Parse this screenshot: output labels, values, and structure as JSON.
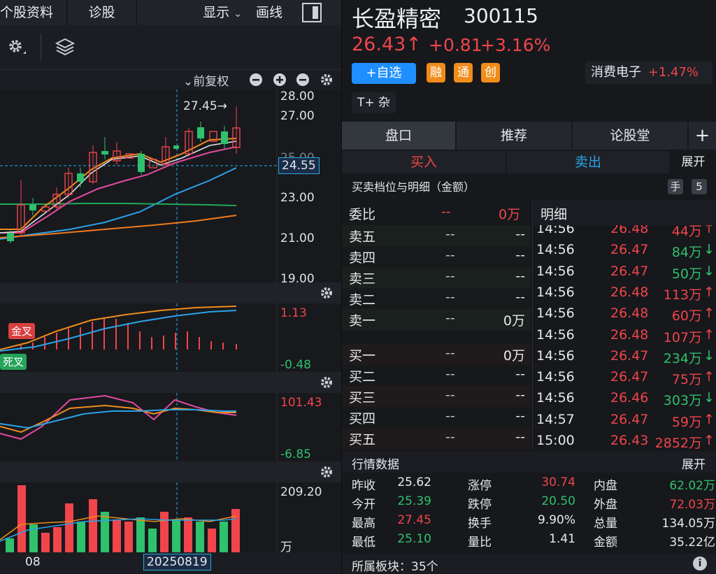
{
  "left": {
    "tabs": [
      "个股资料",
      "诊股"
    ],
    "display_label": "显示",
    "draw_label": "画线",
    "adjust_label": "前复权",
    "price_axis": [
      "28.00",
      "27.00",
      "23.00",
      "21.00",
      "19.00"
    ],
    "price_axis_partial": "25.00",
    "current_price_tag": "24.55",
    "high_marker": "27.45→",
    "macd_axis": [
      "1.13",
      "-0.48"
    ],
    "golden_cross": "金叉",
    "death_cross": "死叉",
    "kdj_axis": [
      "101.43",
      "-6.85"
    ],
    "volume_axis": "209.20",
    "volume_unit": "万",
    "date_left": "08",
    "date_cursor": "20250819"
  },
  "stock": {
    "name": "长盈精密",
    "code": "300115",
    "price": "26.43↑",
    "change": "+0.81",
    "change_pct": "+3.16%",
    "add_watch": "+自选",
    "badges": [
      "融",
      "通",
      "创"
    ],
    "sector_name": "消费电子",
    "sector_pct": "+1.47%",
    "tag": "T+ 杂"
  },
  "tabs": [
    "盘口",
    "推荐",
    "论股堂",
    "+"
  ],
  "trade": {
    "buy": "买入",
    "sell": "卖出",
    "expand": "展开"
  },
  "depth": {
    "title": "买卖档位与明细（金额）",
    "hand_label": "手",
    "hand_count": "5",
    "weibi_label": "委比",
    "weibi_value": "--",
    "weibi_amount": "0万",
    "detail_label": "明细",
    "asks": [
      {
        "label": "卖五",
        "price": "--",
        "vol": "--"
      },
      {
        "label": "卖四",
        "price": "--",
        "vol": "--"
      },
      {
        "label": "卖三",
        "price": "--",
        "vol": "--"
      },
      {
        "label": "卖二",
        "price": "--",
        "vol": "--"
      },
      {
        "label": "卖一",
        "price": "--",
        "vol": "0万"
      }
    ],
    "bids": [
      {
        "label": "买一",
        "price": "--",
        "vol": "0万"
      },
      {
        "label": "买二",
        "price": "--",
        "vol": "--"
      },
      {
        "label": "买三",
        "price": "--",
        "vol": "--"
      },
      {
        "label": "买四",
        "price": "--",
        "vol": "--"
      },
      {
        "label": "买五",
        "price": "--",
        "vol": "--"
      }
    ],
    "trades": [
      {
        "time": "14:56",
        "price": "26.48",
        "vol": "44万",
        "dir": "↑",
        "c": "red"
      },
      {
        "time": "14:56",
        "price": "26.47",
        "vol": "84万",
        "dir": "↓",
        "c": "green"
      },
      {
        "time": "14:56",
        "price": "26.47",
        "vol": "50万",
        "dir": "↓",
        "c": "green"
      },
      {
        "time": "14:56",
        "price": "26.48",
        "vol": "113万",
        "dir": "↑",
        "c": "red"
      },
      {
        "time": "14:56",
        "price": "26.48",
        "vol": "60万",
        "dir": "↑",
        "c": "red"
      },
      {
        "time": "14:56",
        "price": "26.48",
        "vol": "107万",
        "dir": "↑",
        "c": "red"
      },
      {
        "time": "14:56",
        "price": "26.47",
        "vol": "234万",
        "dir": "↓",
        "c": "green"
      },
      {
        "time": "14:56",
        "price": "26.47",
        "vol": "75万",
        "dir": "↑",
        "c": "red"
      },
      {
        "time": "14:56",
        "price": "26.46",
        "vol": "303万",
        "dir": "↓",
        "c": "green"
      },
      {
        "time": "14:57",
        "price": "26.47",
        "vol": "59万",
        "dir": "↑",
        "c": "red"
      },
      {
        "time": "15:00",
        "price": "26.43",
        "vol": "2852万",
        "dir": "↑",
        "c": "red"
      }
    ]
  },
  "market": {
    "title": "行情数据",
    "expand": "展开",
    "rows": [
      [
        {
          "l": "昨收",
          "v": "25.62",
          "c": "white"
        },
        {
          "l": "涨停",
          "v": "30.74",
          "c": "red"
        },
        {
          "l": "内盘",
          "v": "62.02万",
          "c": "green"
        }
      ],
      [
        {
          "l": "今开",
          "v": "25.39",
          "c": "green"
        },
        {
          "l": "跌停",
          "v": "20.50",
          "c": "green"
        },
        {
          "l": "外盘",
          "v": "72.03万",
          "c": "red"
        }
      ],
      [
        {
          "l": "最高",
          "v": "27.45",
          "c": "red"
        },
        {
          "l": "换手",
          "v": "9.90%",
          "c": "white"
        },
        {
          "l": "总量",
          "v": "134.05万",
          "c": "white"
        }
      ],
      [
        {
          "l": "最低",
          "v": "25.10",
          "c": "green"
        },
        {
          "l": "量比",
          "v": "1.41",
          "c": "white"
        },
        {
          "l": "金额",
          "v": "35.22亿",
          "c": "white"
        }
      ]
    ],
    "sector_label": "所属板块：35个"
  },
  "colors": {
    "up": "#f0454a",
    "down": "#2fc16b",
    "accent": "#1f8fff",
    "badge": "#f08c1a"
  }
}
